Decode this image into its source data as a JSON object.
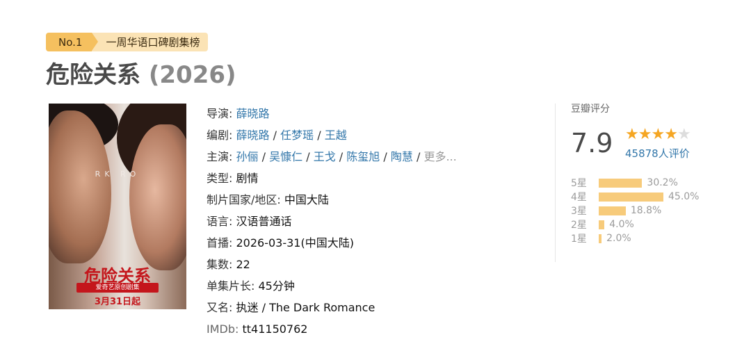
{
  "badge": {
    "rank": "No.1",
    "text": "一周华语口碑剧集榜"
  },
  "title": {
    "name": "危险关系",
    "year": "(2026)"
  },
  "poster": {
    "overlay_text": "RK RO",
    "logo_text": "危险关系",
    "sub_text": "爱奇艺原创剧集",
    "date_text": "3月31日起"
  },
  "info": {
    "director": {
      "label": "导演:",
      "names": [
        "薛晓路"
      ]
    },
    "writers": {
      "label": "编剧:",
      "names": [
        "薛晓路",
        "任梦瑶",
        "王越"
      ]
    },
    "cast": {
      "label": "主演:",
      "names": [
        "孙俪",
        "吴慷仁",
        "王戈",
        "陈玺旭",
        "陶慧"
      ],
      "more": "更多..."
    },
    "genre": {
      "label": "类型:",
      "value": "剧情"
    },
    "country": {
      "label": "制片国家/地区:",
      "value": "中国大陆"
    },
    "language": {
      "label": "语言:",
      "value": "汉语普通话"
    },
    "premiere": {
      "label": "首播:",
      "value": "2026-03-31(中国大陆)"
    },
    "episodes": {
      "label": "集数:",
      "value": "22"
    },
    "duration": {
      "label": "单集片长:",
      "value": "45分钟"
    },
    "aka": {
      "label": "又名:",
      "value": "执迷 / The Dark Romance"
    },
    "imdb": {
      "label": "IMDb:",
      "value": "tt41150762"
    },
    "separator": "/"
  },
  "rating": {
    "title": "豆瓣评分",
    "score": "7.9",
    "stars": 4,
    "votes": "45878人评价",
    "distribution": [
      {
        "label": "5星",
        "percent": 30.2,
        "text": "30.2%"
      },
      {
        "label": "4星",
        "percent": 45.0,
        "text": "45.0%"
      },
      {
        "label": "3星",
        "percent": 18.8,
        "text": "18.8%"
      },
      {
        "label": "2星",
        "percent": 4.0,
        "text": "4.0%"
      },
      {
        "label": "1星",
        "percent": 2.0,
        "text": "2.0%"
      }
    ]
  },
  "colors": {
    "link": "#3377aa",
    "badge_dark": "#f5c05f",
    "badge_light": "#fbe3b5",
    "bar": "#f7cb7b",
    "star": "#f5a623"
  }
}
